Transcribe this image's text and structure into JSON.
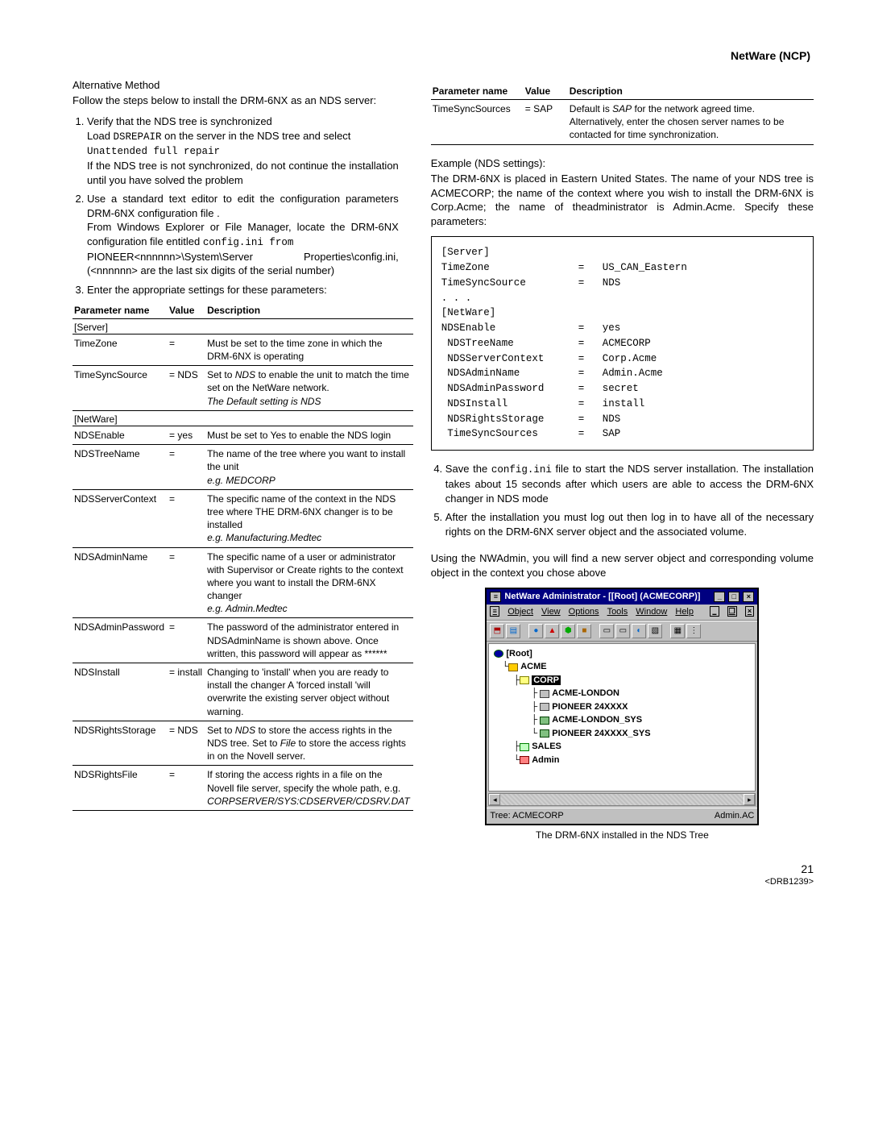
{
  "header": {
    "title": "NetWare (NCP)"
  },
  "left": {
    "subhead": "Alternative Method",
    "intro": "Follow the steps below to install the  DRM-6NX as an NDS server:",
    "steps": {
      "s1a": "Verify that the NDS tree is synchronized",
      "s1b_pre": "Load ",
      "s1b_cmd": "DSREPAIR",
      "s1b_post": " on the server in the NDS tree and select",
      "s1c": "Unattended full repair",
      "s1d": "If the NDS tree is not synchronized, do not continue the installation until you have solved the problem",
      "s2a": "Use a standard text editor to edit the configuration parameters DRM-6NX configuration file .",
      "s2b_pre": "From Windows Explorer or File Manager, locate the DRM-6NX configuration file entitled ",
      "s2b_cmd": "config.ini from",
      "s2c": "PIONEER<nnnnnn>\\System\\Server Properties\\config.ini, (<nnnnnn> are the last six digits of the serial number)",
      "s3": "Enter the appropriate settings for these parameters:"
    },
    "th": {
      "name": "Parameter name",
      "value": "Value",
      "description": "Description"
    },
    "sect_server": "[Server]",
    "sect_netware": "[NetWare]",
    "rows": {
      "r1": {
        "n": "TimeZone",
        "v": "=",
        "d": "Must be set to the  time zone in which the DRM-6NX is operating"
      },
      "r2": {
        "n": "TimeSyncSource",
        "v": "= NDS",
        "d1": "Set to ",
        "d1i": "NDS",
        "d1b": " to enable the unit to match the time set on the NetWare network.",
        "d2": "The Default setting is NDS"
      },
      "r3": {
        "n": "NDSEnable",
        "v": "= yes",
        "d": "Must be set to Yes to enable the NDS login"
      },
      "r4": {
        "n": "NDSTreeName",
        "v": "=",
        "d1": "The name of the tree where you want to install the unit",
        "d2": "e.g. MEDCORP"
      },
      "r5": {
        "n": "NDSServerContext",
        "v": "=",
        "d1": "The specific name of the context in the NDS tree where THE DRM-6NX changer is to be installed",
        "d2": "e.g. Manufacturing.Medtec"
      },
      "r6": {
        "n": "NDSAdminName",
        "v": "=",
        "d1": "The specific name of a user or administrator with Supervisor or Create rights to the context where you want to install the DRM-6NX changer",
        "d2": "e.g. Admin.Medtec"
      },
      "r7": {
        "n": "NDSAdminPassword",
        "v": "=",
        "d": "The password of the administrator entered in NDSAdminName is shown above. Once written, this password will appear as ******"
      },
      "r8": {
        "n": "NDSInstall",
        "v": "= install",
        "d": "Changing to 'install' when you are ready to install the changer A 'forced install 'will overwrite the existing server object without warning."
      },
      "r9": {
        "n": "NDSRightsStorage",
        "v": "= NDS",
        "d1": "Set to ",
        "d1i": "NDS",
        "d1b": " to store the access rights in the NDS tree. Set to ",
        "d2i": "File",
        "d2b": " to store the access rights in on the Novell server."
      },
      "r10": {
        "n": "NDSRightsFile",
        "v": "=",
        "d1": "If storing the access rights in a file on the Novell file server, specify the whole path, e.g.",
        "d2": "CORPSERVER/SYS:CDSERVER/CDSRV.DAT"
      }
    }
  },
  "right": {
    "th": {
      "name": "Parameter name",
      "value": "Value",
      "description": "Description"
    },
    "row": {
      "n": "TimeSyncSources",
      "v": "= SAP",
      "d1": "Default is ",
      "d1i": "SAP",
      "d1b": " for the network agreed time.  Alternatively, enter the chosen server names to be contacted for time synchronization."
    },
    "example_head": "Example (NDS settings):",
    "example_para": "The DRM-6NX is placed in Eastern United States. The name of your NDS tree is ACMECORP; the name of the context where you wish to install the DRM-6NX is Corp.Acme;  the name of theadministrator is Admin.Acme.  Specify these parameters:",
    "ex": {
      "sect_server": "[Server]",
      "sect_netware": "[NetWare]",
      "rows": [
        {
          "k": "TimeZone",
          "v": "US_CAN_Eastern"
        },
        {
          "k": "TimeSyncSource",
          "v": "NDS"
        }
      ],
      "dots": ". . .",
      "rows2": [
        {
          "k": "NDSEnable",
          "v": "yes"
        },
        {
          "k": "NDSTreeName",
          "v": "ACMECORP",
          "indent": true
        },
        {
          "k": "NDSServerContext",
          "v": "Corp.Acme",
          "indent": true
        },
        {
          "k": "NDSAdminName",
          "v": "Admin.Acme",
          "indent": true
        },
        {
          "k": "NDSAdminPassword",
          "v": "secret",
          "indent": true
        },
        {
          "k": "NDSInstall",
          "v": "install",
          "indent": true
        },
        {
          "k": "NDSRightsStorage",
          "v": "NDS",
          "indent": true
        },
        {
          "k": "TimeSyncSources",
          "v": "SAP",
          "indent": true
        }
      ]
    },
    "step4_pre": "Save the ",
    "step4_cmd": "config.ini",
    "step4_post": " file to start the NDS server installation. The installation takes about 15 seconds after which users are able to access the DRM-6NX changer in NDS mode",
    "step5": "After the installation you must log out then log in to have all of the necessary rights on the DRM-6NX server object and the associated volume.",
    "closing": "Using the NWAdmin, you will find a new server object and corresponding volume object in the context you chose above",
    "nwa": {
      "title": "NetWare Administrator - [[Root] (ACMECORP)]",
      "menus": [
        "Object",
        "View",
        "Options",
        "Tools",
        "Window",
        "Help"
      ],
      "tree": {
        "root": "[Root]",
        "org": "ACME",
        "ou": "CORP",
        "items": [
          "ACME-LONDON",
          "PIONEER 24XXXX",
          "ACME-LONDON_SYS",
          "PIONEER 24XXXX_SYS"
        ],
        "grp": "SALES",
        "usr": "Admin"
      },
      "status_left": "Tree: ACMECORP",
      "status_right": "Admin.AC",
      "caption": "The DRM-6NX installed in the NDS Tree"
    }
  },
  "footer": {
    "page": "21",
    "docid": "<DRB1239>"
  }
}
